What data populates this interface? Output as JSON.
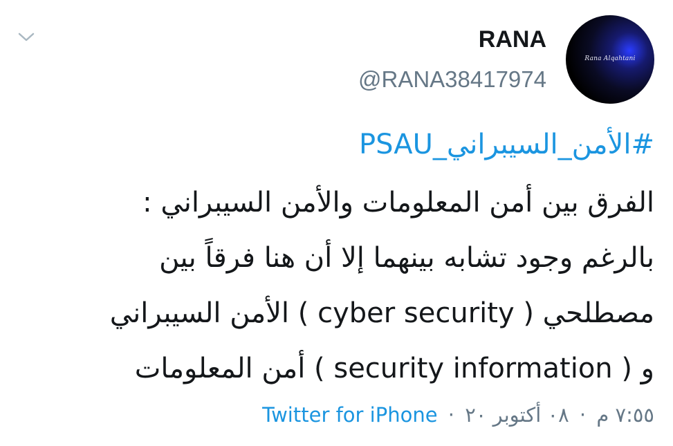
{
  "tweet": {
    "display_name": "RANA",
    "handle": "@RANA38417974",
    "avatar_text": "Rana Alqahtani",
    "hashtag": "#الأمن_السيبراني_PSAU",
    "lines": [
      "الفرق بين أمن المعلومات والأمن السيبراني :",
      "بالرغم وجود تشابه بينهما إلا أن هنا فرقاً بين",
      "مصطلحي ( cyber security ) الأمن السيبراني",
      "و ( security information ) أمن المعلومات"
    ],
    "time": "٧:٥٥ م",
    "date": "٠٨ أكتوبر ٢٠",
    "separator": "·",
    "source": "Twitter for iPhone"
  },
  "icons": {
    "menu": "chevron-down-icon"
  },
  "colors": {
    "link": "#1b95e0",
    "secondary_text": "#657786",
    "primary_text": "#14171a",
    "chevron": "#aab8c2"
  }
}
